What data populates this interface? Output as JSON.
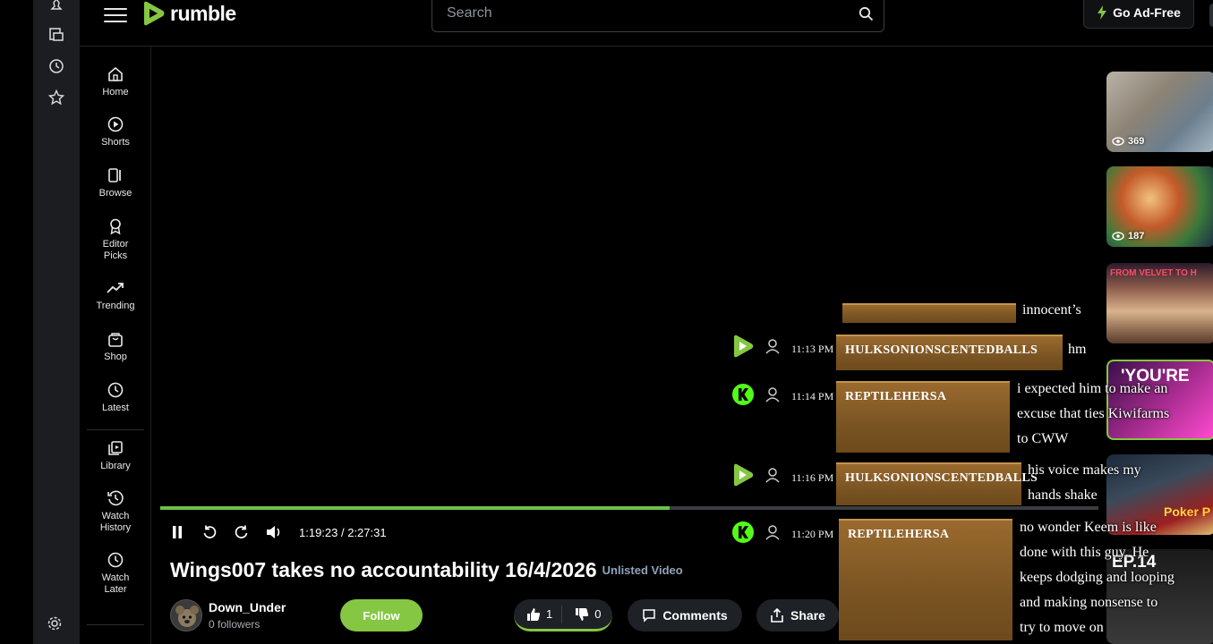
{
  "mini_rail": {
    "icons": [
      "pin-icon",
      "film-icon",
      "clock-icon",
      "star-icon"
    ],
    "settings_icon": "gear-icon"
  },
  "header": {
    "logo_text": "rumble",
    "search_placeholder": "Search",
    "ad_free_label": "Go Ad-Free"
  },
  "sidebar": {
    "items": [
      {
        "label": "Home",
        "icon": "home-icon"
      },
      {
        "label": "Shorts",
        "icon": "shorts-icon"
      },
      {
        "label": "Browse",
        "icon": "browse-icon"
      },
      {
        "label": "Editor Picks",
        "icon": "award-icon"
      },
      {
        "label": "Trending",
        "icon": "trending-icon"
      },
      {
        "label": "Shop",
        "icon": "shop-icon"
      },
      {
        "label": "Latest",
        "icon": "clock-icon"
      },
      {
        "label": "Library",
        "icon": "library-icon"
      },
      {
        "label": "Watch History",
        "icon": "history-icon"
      },
      {
        "label": "Watch Later",
        "icon": "clock-icon"
      }
    ]
  },
  "player": {
    "progress_fraction": 0.543,
    "time": "1:19:23 / 2:27:31"
  },
  "video": {
    "title": "Wings007 takes no accountability 16/4/2026",
    "status": "Unlisted Video",
    "channel": "Down_Under",
    "followers": "0 followers",
    "follow_label": "Follow",
    "likes": "1",
    "dislikes": "0",
    "comments_label": "Comments",
    "share_label": "Share"
  },
  "chat": {
    "partial_message": "innocent’s",
    "messages": [
      {
        "time": "11:13 PM",
        "user": "HULKSONIONSCENTEDBALLS",
        "badge": "rumble",
        "text": [
          "hm"
        ]
      },
      {
        "time": "11:14 PM",
        "user": "REPTILEHERSA",
        "badge": "kick",
        "text": [
          "i expected him to make an",
          "excuse that ties Kiwifarms",
          "to CWW"
        ]
      },
      {
        "time": "11:16 PM",
        "user": "HULKSONIONSCENTEDBALLS",
        "badge": "rumble",
        "text": [
          "his voice makes my",
          "hands shake"
        ]
      },
      {
        "time": "11:20 PM",
        "user": "REPTILEHERSA",
        "badge": "kick",
        "text": [
          "no wonder Keem is like",
          "done with this guy. He",
          "keeps dodging and looping",
          "and making nonsense to",
          "try to move on"
        ]
      }
    ]
  },
  "recommended": [
    {
      "views": "369"
    },
    {
      "views": "187"
    },
    {
      "caption": "FROM VELVET TO H"
    },
    {
      "caption": "'YOU'RE"
    },
    {
      "caption": "Poker P"
    },
    {
      "caption": "EP.14"
    }
  ],
  "colors": {
    "accent": "#85c742",
    "progress": "#6cc04a",
    "nameplate": "#8a5e27"
  }
}
